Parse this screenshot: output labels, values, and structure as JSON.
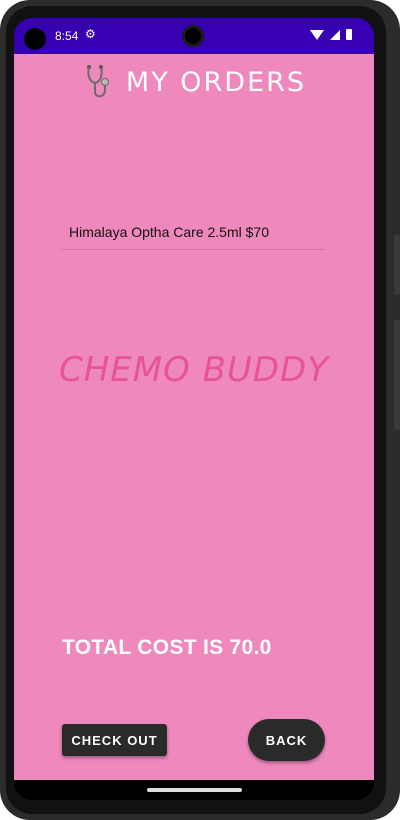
{
  "status_bar": {
    "time": "8:54",
    "icons": [
      "gear-icon",
      "wifi-icon",
      "signal-icon",
      "battery-icon"
    ]
  },
  "header": {
    "title": "MY ORDERS",
    "icon": "stethoscope-icon"
  },
  "orders": [
    {
      "text": "Himalaya Optha Care 2.5ml $70"
    }
  ],
  "watermark": "CHEMO BUDDY",
  "total_text": "TOTAL COST IS 70.0",
  "buttons": {
    "checkout": "CHECK OUT",
    "back": "BACK"
  },
  "colors": {
    "background": "#ee88bd",
    "status_bar": "#3700b3",
    "button": "#2a2a2a",
    "watermark": "#e8529a"
  }
}
